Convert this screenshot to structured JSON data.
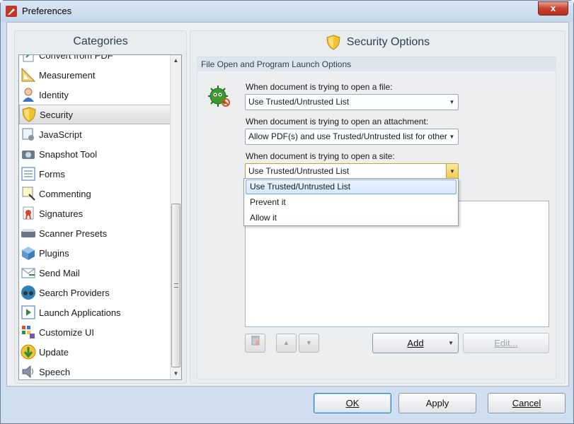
{
  "window": {
    "title": "Preferences",
    "close_label": "x"
  },
  "categories": {
    "header": "Categories",
    "items": [
      {
        "label": "Convert from PDF",
        "icon": "convert-pdf-icon"
      },
      {
        "label": "Measurement",
        "icon": "ruler-icon"
      },
      {
        "label": "Identity",
        "icon": "user-icon"
      },
      {
        "label": "Security",
        "icon": "shield-icon",
        "selected": true
      },
      {
        "label": "JavaScript",
        "icon": "script-gear-icon"
      },
      {
        "label": "Snapshot Tool",
        "icon": "camera-icon"
      },
      {
        "label": "Forms",
        "icon": "form-icon"
      },
      {
        "label": "Commenting",
        "icon": "comment-icon"
      },
      {
        "label": "Signatures",
        "icon": "ribbon-award-icon"
      },
      {
        "label": "Scanner Presets",
        "icon": "scanner-icon"
      },
      {
        "label": "Plugins",
        "icon": "plugin-cube-icon"
      },
      {
        "label": "Send Mail",
        "icon": "mail-icon"
      },
      {
        "label": "Search Providers",
        "icon": "binoculars-icon"
      },
      {
        "label": "Launch Applications",
        "icon": "launch-icon"
      },
      {
        "label": "Customize UI",
        "icon": "customize-grid-icon"
      },
      {
        "label": "Update",
        "icon": "update-arrow-icon"
      },
      {
        "label": "Speech",
        "icon": "speaker-icon"
      }
    ]
  },
  "security": {
    "header": "Security Options",
    "group_title": "File Open and Program Launch Options",
    "file_label": "When document is trying to open a file:",
    "file_value": "Use Trusted/Untrusted List",
    "attachment_label": "When document is trying to open an attachment:",
    "attachment_value": "Allow PDF(s) and use Trusted/Untrusted list for other",
    "site_label": "When document is trying to open a site:",
    "site_value": "Use Trusted/Untrusted List",
    "site_options": [
      "Use Trusted/Untrusted List",
      "Prevent it",
      "Allow it"
    ],
    "add_label": "Add",
    "edit_label": "Edit..."
  },
  "footer": {
    "ok": "OK",
    "apply": "Apply",
    "cancel": "Cancel"
  },
  "colors": {
    "accent_shield": "#f0c020",
    "danger": "#c0392b",
    "highlight": "#d3e6fb"
  }
}
